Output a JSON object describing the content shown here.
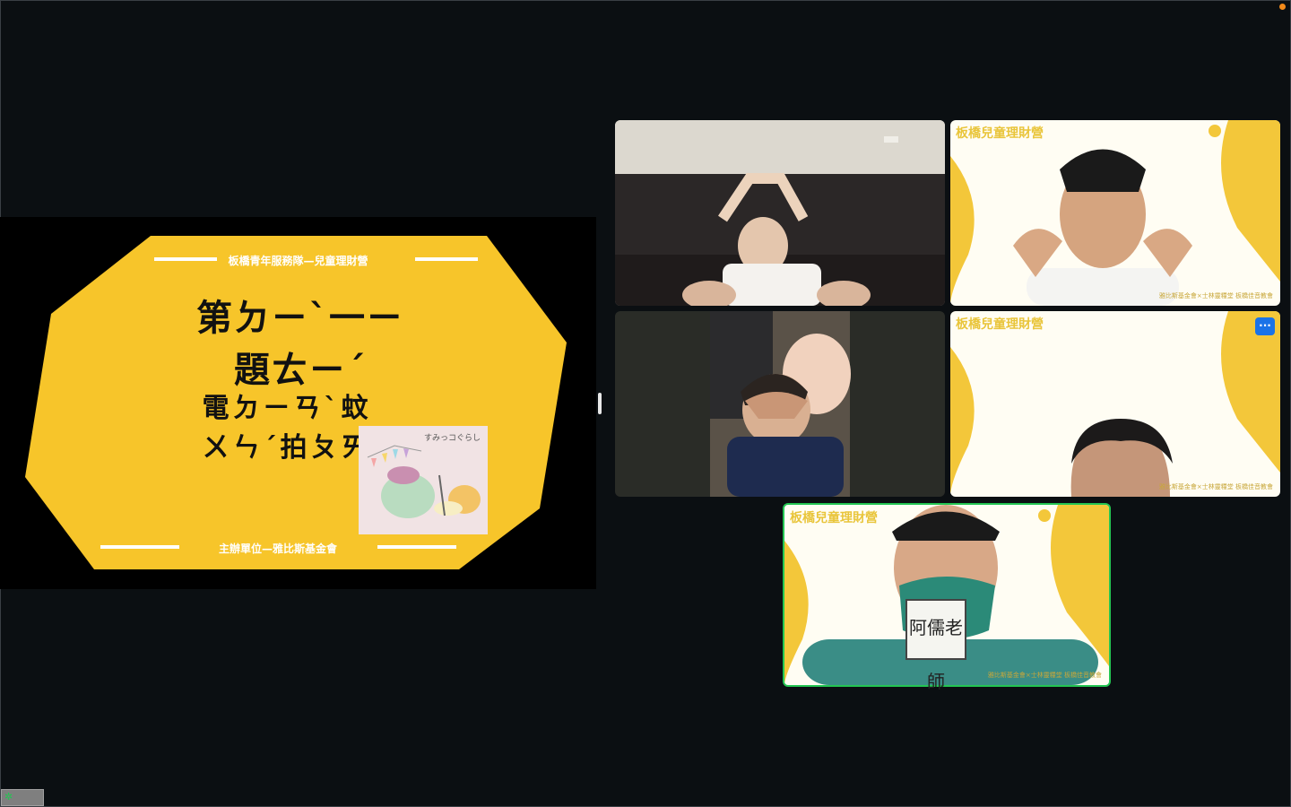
{
  "slide": {
    "header": "板橋青年服務隊—兒童理財營",
    "title": "第ㄉㄧˋ一ㄧ題ㄊㄧˊ",
    "word": "電ㄉㄧㄢˋ蚊ㄨㄣˊ拍ㄆㄞ",
    "footer": "主辦單位—雅比斯基金會",
    "sticker_caption": "すみっコぐらし",
    "color_yellow": "#f7c52a"
  },
  "tiles": {
    "bg_title": "板橋兒童理財營",
    "bg_caption": "雅比斯基金會×士林靈糧堂 板橋佳音教會",
    "more_icon": "···",
    "badge_text": "阿儒老師"
  },
  "colors": {
    "active_speaker": "#23c552",
    "button_blue": "#1a73e8",
    "background": "#0b0f12"
  },
  "taskbar": {
    "icon": "✲"
  }
}
